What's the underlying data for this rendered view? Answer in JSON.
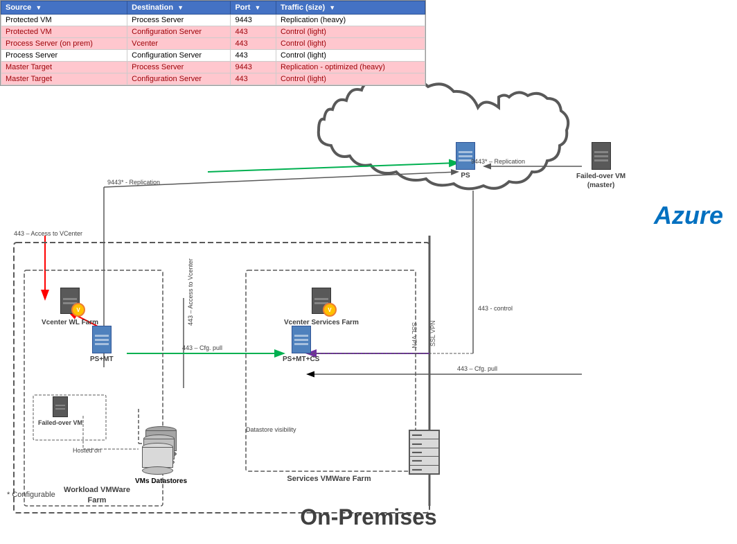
{
  "table": {
    "headers": [
      "Source",
      "Destination",
      "Port",
      "Traffic (size)"
    ],
    "rows": [
      {
        "source": "Protected VM",
        "destination": "Process Server",
        "port": "9443",
        "traffic": "Replication (heavy)",
        "style": "odd"
      },
      {
        "source": "Protected VM",
        "destination": "Configuration Server",
        "port": "443",
        "traffic": "Control (light)",
        "style": "highlight"
      },
      {
        "source": "Process Server (on prem)",
        "destination": "Vcenter",
        "port": "443",
        "traffic": "Control (light)",
        "style": "highlight2"
      },
      {
        "source": "Process Server",
        "destination": "Configuration Server",
        "port": "443",
        "traffic": "Control (light)",
        "style": "odd"
      },
      {
        "source": "Master Target",
        "destination": "Process Server",
        "port": "9443",
        "traffic": "Replication - optimized (heavy)",
        "style": "highlight"
      },
      {
        "source": "Master Target",
        "destination": "Configuration Server",
        "port": "443",
        "traffic": "Control (light)",
        "style": "highlight2"
      }
    ]
  },
  "diagram": {
    "azure_label": "Azure",
    "onprem_label": "On-Premises",
    "config_note": "* Configurable",
    "ps_label": "PS",
    "failed_over_vm_label": "Failed-over VM\n(master)",
    "ps_mt_label": "PS+MT",
    "ps_mt_cs_label": "PS+MT+CS",
    "vcenter_wl_farm_label": "Vcenter WL Farm",
    "vcenter_services_farm_label": "Vcenter Services Farm",
    "failed_over_vm_onprem_label": "Failed-over VM",
    "workload_vmware_label": "Workload VMWare\nFarm",
    "services_vmware_label": "Services VMWare Farm",
    "vms_datastores_label": "VMs Datastores",
    "datastore_visibility_label": "Datastore visibility",
    "hosted_on_label": "Hosted on",
    "arrows": {
      "replication_9443_cloud": "9443* – Replication",
      "replication_9443_main": "9443* - Replication",
      "access_vcenter_443": "443 – Access to VCenter",
      "access_vcenter_443_2": "443 – Access to\nVcenter",
      "cfg_pull_443": "443 – Cfg. pull",
      "cfg_pull_443_2": "443 – Cfg. pull",
      "control_443": "443 - control",
      "ssl_vpn": "SSL VPN"
    }
  }
}
